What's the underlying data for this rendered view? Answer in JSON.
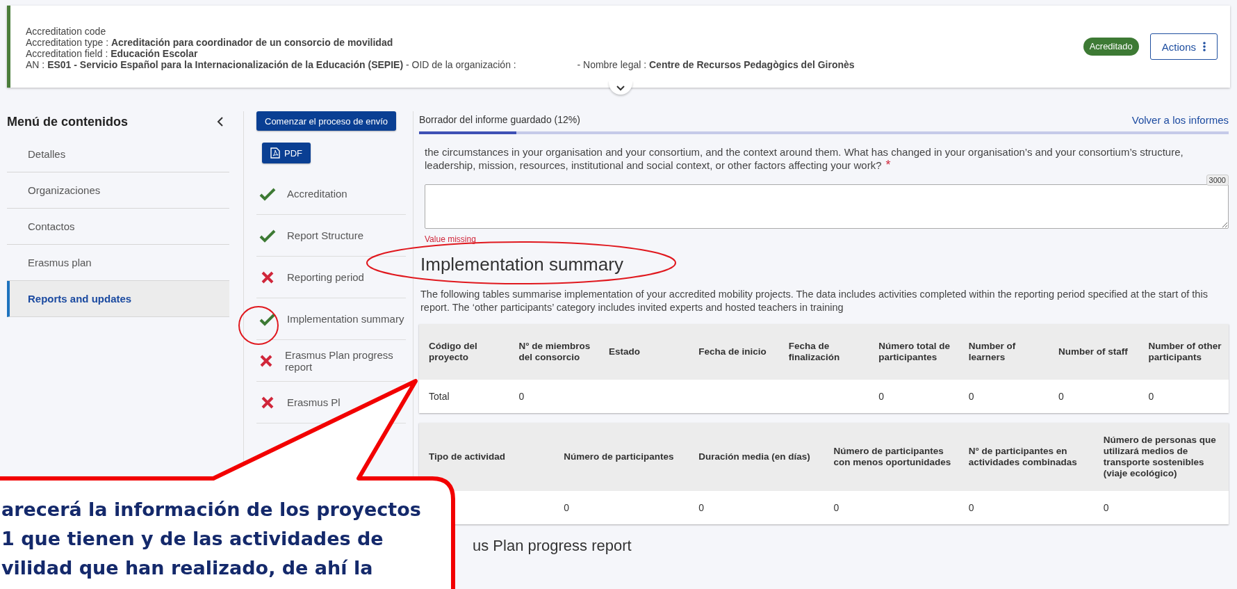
{
  "header": {
    "lines": [
      {
        "label": "Accreditation code"
      },
      {
        "label": "Accreditation type : ",
        "value": "Acreditación para coordinador de un consorcio de movilidad"
      },
      {
        "label": "Accreditation field : ",
        "value": "Educación Escolar"
      }
    ],
    "an_line": {
      "label": "AN : ",
      "value": "ES01 - Servicio Español para la Internacionalización de la Educación (SEPIE)",
      "oid_label": " - OID de la organización : ",
      "legal_label": " - Nombre legal : ",
      "legal_value": "Centre de Recursos Pedagògics del Gironès"
    },
    "badge": "Acreditado",
    "actions_button": "Actions"
  },
  "sidebar": {
    "title": "Menú de contenidos",
    "items": [
      {
        "label": "Detalles",
        "selected": false
      },
      {
        "label": "Organizaciones",
        "selected": false
      },
      {
        "label": "Contactos",
        "selected": false
      },
      {
        "label": "Erasmus plan",
        "selected": false
      },
      {
        "label": "Reports and updates",
        "selected": true
      }
    ]
  },
  "steps": {
    "submit_button": "Comenzar el proceso de envío",
    "pdf_button": "PDF",
    "items": [
      {
        "label": "Accreditation",
        "complete": true
      },
      {
        "label": "Report Structure",
        "complete": true
      },
      {
        "label": "Reporting period",
        "complete": false
      },
      {
        "label": "Implementation summary",
        "complete": true
      },
      {
        "label": "Erasmus Plan progress report",
        "complete": false
      },
      {
        "label": "Erasmus Pl",
        "complete": false
      }
    ]
  },
  "progress": {
    "label": "Borrador del informe guardado (12%)",
    "level": 0.12,
    "back_link": "Volver a los informes"
  },
  "question": {
    "text": "the circumstances in your organisation and your consortium, and the context around them. What has changed in your organisation’s and your consortium’s structure, leadership, mission, resources, institutional and social context, or other factors affecting your work?",
    "required_mark": "*",
    "counter": "3000",
    "error": "Value missing"
  },
  "section": {
    "title": "Implementation summary",
    "intro": "The following tables summarise implementation of your accredited mobility projects. The data includes activities completed within the reporting period specified at the start of this report. The ‘other participants’ category includes invited experts and hosted teachers in training"
  },
  "table_projects": {
    "columns": [
      "Código del proyecto",
      "N° de miembros del consorcio",
      "Estado",
      "Fecha de inicio",
      "Fecha de finalización",
      "Número total de participantes",
      "Number of learners",
      "Number of staff",
      "Number of other participants"
    ],
    "rows": [
      [
        "Total",
        "0",
        "",
        "",
        "",
        "0",
        "0",
        "0",
        "0"
      ]
    ]
  },
  "table_activities": {
    "columns": [
      "Tipo de actividad",
      "Número de participantes",
      "Duración media (en días)",
      "Número de participantes con menos oportunidades",
      "N° de participantes en actividades combinadas",
      "Número de personas que utilizará medios de transporte sostenibles (viaje ecológico)"
    ],
    "rows": [
      [
        "",
        "0",
        "0",
        "0",
        "0",
        "0"
      ]
    ]
  },
  "next_section": {
    "title": "us Plan progress report"
  },
  "callout": {
    "lines": [
      "arecerá la información de los proyectos",
      "1 que tienen y de las actividades de",
      "vilidad que han realizado, de ahí la"
    ]
  }
}
